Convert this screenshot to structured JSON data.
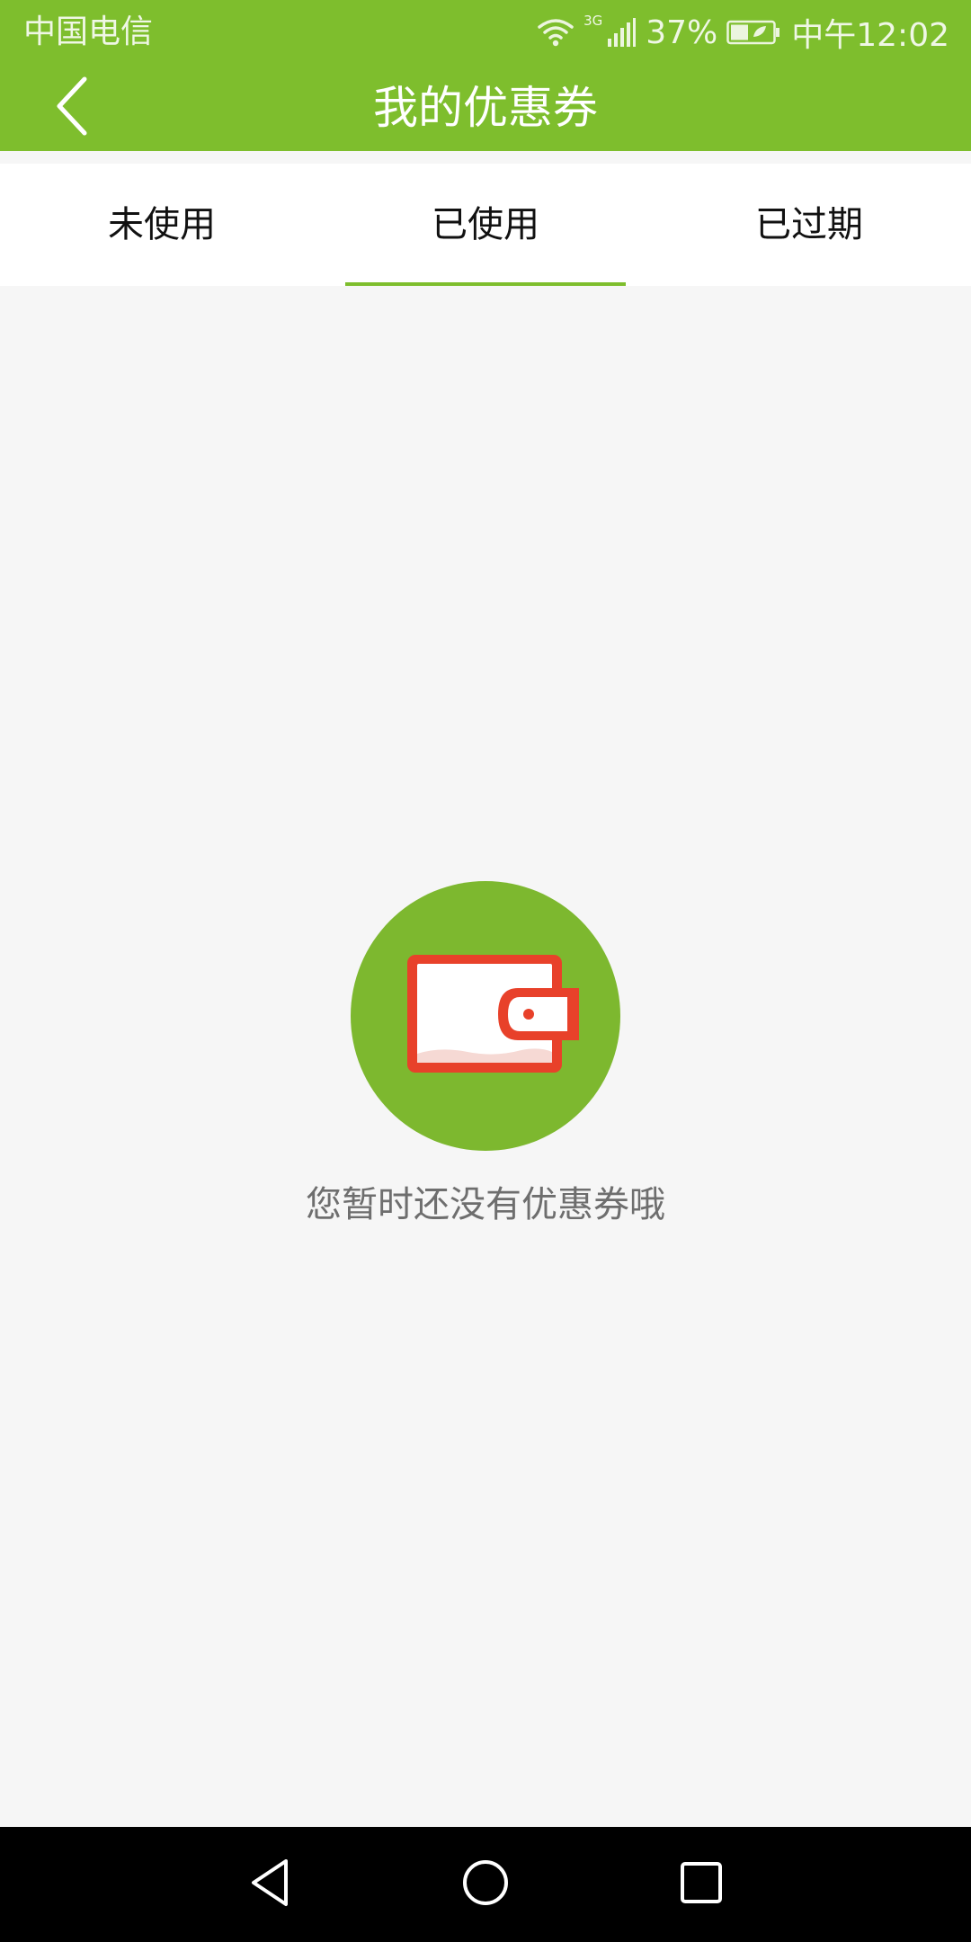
{
  "status_bar": {
    "carrier": "中国电信",
    "network": "3G",
    "battery": "37%",
    "time": "中午12:02",
    "icons": [
      "wifi-icon",
      "signal-icon",
      "battery-icon"
    ]
  },
  "header": {
    "title": "我的优惠券",
    "back_icon": "chevron-left-icon"
  },
  "tabs": [
    {
      "label": "未使用",
      "selected": false
    },
    {
      "label": "已使用",
      "selected": true
    },
    {
      "label": "已过期",
      "selected": false
    }
  ],
  "empty_state": {
    "icon": "wallet-icon",
    "message": "您暂时还没有优惠券哦"
  },
  "nav_bar": {
    "icons": [
      "back-triangle-icon",
      "home-circle-icon",
      "recent-apps-square-icon"
    ]
  },
  "colors": {
    "brand": "#7ebe2d",
    "wallet": "#e8412a",
    "background": "#f6f6f6"
  }
}
